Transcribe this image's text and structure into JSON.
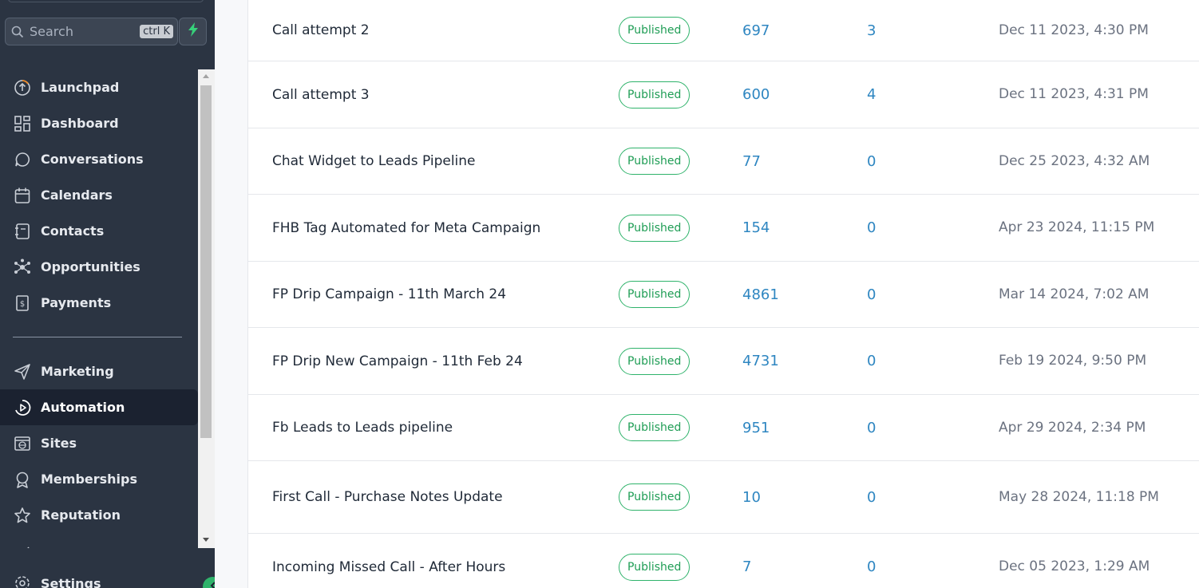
{
  "sidebar": {
    "search": {
      "placeholder": "Search",
      "shortcut": "ctrl K"
    },
    "items": [
      {
        "label": "Launchpad",
        "icon": "launchpad-icon"
      },
      {
        "label": "Dashboard",
        "icon": "dashboard-icon"
      },
      {
        "label": "Conversations",
        "icon": "chat-bubble-icon"
      },
      {
        "label": "Calendars",
        "icon": "calendar-icon"
      },
      {
        "label": "Contacts",
        "icon": "contacts-book-icon"
      },
      {
        "label": "Opportunities",
        "icon": "opportunities-network-icon"
      },
      {
        "label": "Payments",
        "icon": "payments-receipt-icon"
      },
      {
        "label": "Marketing",
        "icon": "send-paper-plane-icon"
      },
      {
        "label": "Automation",
        "icon": "automation-play-icon",
        "active": true
      },
      {
        "label": "Sites",
        "icon": "sites-globe-icon"
      },
      {
        "label": "Memberships",
        "icon": "membership-badge-icon"
      },
      {
        "label": "Reputation",
        "icon": "star-icon"
      }
    ],
    "settings_label": "Settings",
    "accent_color": "#2fb36b"
  },
  "table": {
    "rows": [
      {
        "name": "Call attempt 2",
        "status": "Published",
        "total": "697",
        "active": "3",
        "date": "Dec 11 2023, 4:30 PM"
      },
      {
        "name": "Call attempt 3",
        "status": "Published",
        "total": "600",
        "active": "4",
        "date": "Dec 11 2023, 4:31 PM"
      },
      {
        "name": "Chat Widget to Leads Pipeline",
        "status": "Published",
        "total": "77",
        "active": "0",
        "date": "Dec 25 2023, 4:32 AM"
      },
      {
        "name": "FHB Tag Automated for Meta Campaign",
        "status": "Published",
        "total": "154",
        "active": "0",
        "date": "Apr 23 2024, 11:15 PM"
      },
      {
        "name": "FP Drip Campaign - 11th March 24",
        "status": "Published",
        "total": "4861",
        "active": "0",
        "date": "Mar 14 2024, 7:02 AM"
      },
      {
        "name": "FP Drip New Campaign - 11th Feb 24",
        "status": "Published",
        "total": "4731",
        "active": "0",
        "date": "Feb 19 2024, 9:50 PM"
      },
      {
        "name": "Fb Leads to Leads pipeline",
        "status": "Published",
        "total": "951",
        "active": "0",
        "date": "Apr 29 2024, 2:34 PM"
      },
      {
        "name": "First Call - Purchase Notes Update",
        "status": "Published",
        "total": "10",
        "active": "0",
        "date": "May 28 2024, 11:18 PM"
      },
      {
        "name": "Incoming Missed Call - After Hours",
        "status": "Published",
        "total": "7",
        "active": "0",
        "date": "Dec 05 2023, 1:29 AM"
      }
    ]
  }
}
